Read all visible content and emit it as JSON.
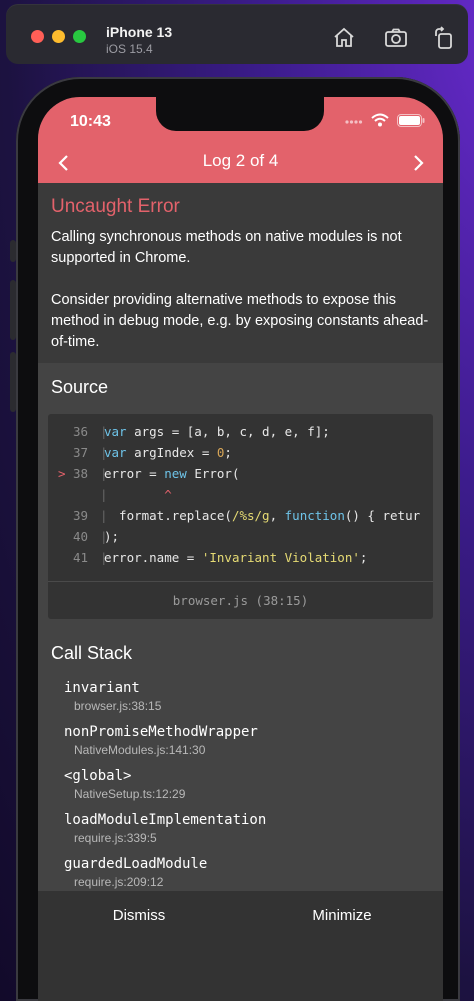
{
  "simulator": {
    "device": "iPhone 13",
    "os": "iOS 15.4"
  },
  "status_bar": {
    "time": "10:43"
  },
  "header": {
    "title": "Log 2 of 4"
  },
  "error": {
    "title": "Uncaught Error",
    "message": "Calling synchronous methods on native modules is not supported in Chrome.\n\n Consider providing alternative methods to expose this method in debug mode, e.g. by exposing constants ahead-of-time."
  },
  "source": {
    "title": "Source",
    "lines": [
      {
        "num": "36",
        "marker": "",
        "text": "var args = [a, b, c, d, e, f];"
      },
      {
        "num": "37",
        "marker": "",
        "text": "var argIndex = 0;"
      },
      {
        "num": "38",
        "marker": ">",
        "text": "error = new Error("
      },
      {
        "num": "",
        "marker": "",
        "text": "        ^"
      },
      {
        "num": "39",
        "marker": "",
        "text": "  format.replace(/%s/g, function() { retur"
      },
      {
        "num": "40",
        "marker": "",
        "text": ");"
      },
      {
        "num": "41",
        "marker": "",
        "text": "error.name = 'Invariant Violation';"
      }
    ],
    "footer": "browser.js (38:15)"
  },
  "call_stack": {
    "title": "Call Stack",
    "frames": [
      {
        "name": "invariant",
        "location": "browser.js:38:15"
      },
      {
        "name": "nonPromiseMethodWrapper",
        "location": "NativeModules.js:141:30"
      },
      {
        "name": "<global>",
        "location": "NativeSetup.ts:12:29"
      },
      {
        "name": "loadModuleImplementation",
        "location": "require.js:339:5"
      },
      {
        "name": "guardedLoadModule",
        "location": "require.js:209:12"
      }
    ]
  },
  "footer": {
    "dismiss": "Dismiss",
    "minimize": "Minimize"
  },
  "colors": {
    "accent": "#e3626b",
    "background": "#3a3a3a"
  }
}
